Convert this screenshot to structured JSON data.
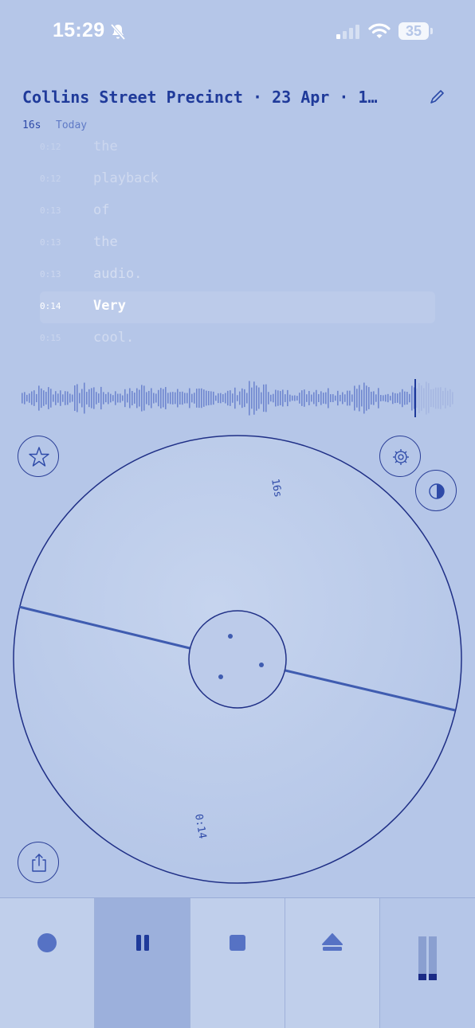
{
  "status": {
    "time": "15:29",
    "battery": "35",
    "icons": [
      "bell-slash-icon",
      "cellular-signal-icon",
      "wifi-icon",
      "battery-icon"
    ]
  },
  "header": {
    "title": "Collins Street Precinct · 23 Apr · 1…",
    "duration": "16s",
    "date": "Today",
    "edit_icon": "pencil-icon"
  },
  "transcript": [
    {
      "time": "0:12",
      "word": "the"
    },
    {
      "time": "0:12",
      "word": "playback"
    },
    {
      "time": "0:13",
      "word": "of"
    },
    {
      "time": "0:13",
      "word": "the"
    },
    {
      "time": "0:13",
      "word": "audio."
    },
    {
      "time": "0:14",
      "word": "Very",
      "active": true
    },
    {
      "time": "0:15",
      "word": "cool."
    }
  ],
  "playback": {
    "progress": 0.91
  },
  "dial": {
    "total_label": "16s",
    "position_label": "0:14"
  },
  "buttons": {
    "favorite": "star-icon",
    "settings": "gear-icon",
    "theme": "contrast-icon",
    "share": "share-icon"
  },
  "toolbar": {
    "items": [
      "record-icon",
      "pause-icon",
      "stop-icon",
      "eject-icon",
      "level-meter-icon"
    ],
    "active": "pause"
  },
  "colors": {
    "background": "#b5c6e8",
    "accent": "#1f3a9a",
    "waveform": "#6f86cf"
  }
}
